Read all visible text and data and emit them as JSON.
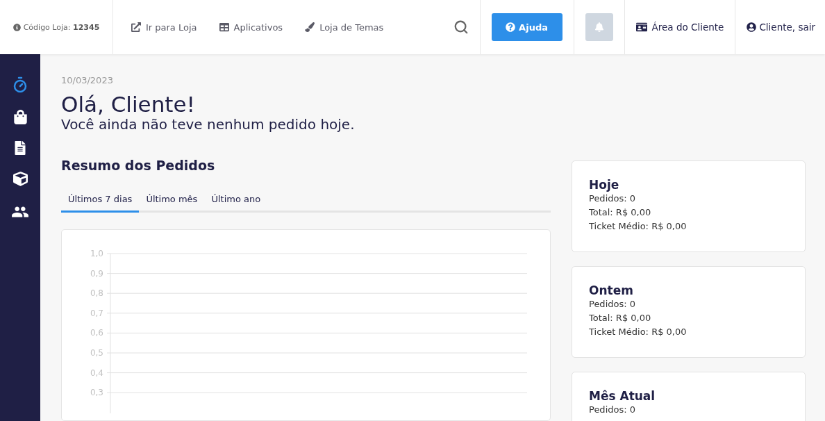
{
  "header": {
    "store_code": "Código Loja: **12345**",
    "nav": [
      {
        "kind": "external",
        "label": "Ir para Loja"
      },
      {
        "kind": "apps",
        "label": "Aplicativos"
      },
      {
        "kind": "themes",
        "label": "Loja de Temas"
      }
    ],
    "help_button": "Ajuda",
    "client_area": "Área do Cliente",
    "logout": "Cliente, sair"
  },
  "sidebar": {
    "items": [
      {
        "kind": "dashboard",
        "selected": true
      },
      {
        "kind": "orders",
        "selected": false
      },
      {
        "kind": "documents",
        "selected": false
      },
      {
        "kind": "products",
        "selected": false
      },
      {
        "kind": "customers",
        "selected": false
      }
    ]
  },
  "date": "10/03/2023",
  "greeting": "Olá, Cliente!",
  "subtitle": "Você ainda não teve nenhum pedido hoje.",
  "summary": {
    "title": "Resumo dos Pedidos",
    "tabs": [
      {
        "label": "Últimos 7 dias",
        "selected": true
      },
      {
        "label": "Último mês",
        "selected": false
      },
      {
        "label": "Último ano",
        "selected": false
      }
    ],
    "chart": {
      "y_labels": [
        "1,0",
        "0,9",
        "0,8",
        "0,7",
        "0,6",
        "0,5",
        "0,4",
        "0,3"
      ]
    }
  },
  "cards": [
    {
      "title": "Hoje",
      "lines": [
        "Pedidos: 0",
        "Total: R$ 0,00",
        "Ticket Médio: R$ 0,00"
      ]
    },
    {
      "title": "Ontem",
      "lines": [
        "Pedidos: 0",
        "Total: R$ 0,00",
        "Ticket Médio: R$ 0,00"
      ]
    },
    {
      "title": "Mês Atual",
      "lines": [
        "Pedidos: 0"
      ]
    }
  ]
}
